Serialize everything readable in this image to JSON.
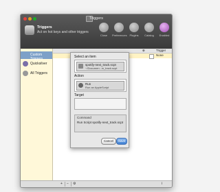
{
  "window": {
    "title": "Triggers"
  },
  "header": {
    "title": "Triggers",
    "subtitle": "Act on hot keys and other triggers"
  },
  "toolbar": {
    "buttons": [
      {
        "label": "Close"
      },
      {
        "label": "Preferences"
      },
      {
        "label": "Plugins"
      },
      {
        "label": "Catalog"
      },
      {
        "label": "Enabled"
      }
    ]
  },
  "sidebar": {
    "items": [
      {
        "label": "Custom Triggers"
      },
      {
        "label": "Quicksilver"
      },
      {
        "label": "All Triggers"
      }
    ]
  },
  "table": {
    "columns": [
      "Trigger"
    ],
    "row": {
      "trigger": "None"
    }
  },
  "sheet": {
    "select_label": "Select an item",
    "selected_item": {
      "title": "spotify-next_track.scpt",
      "subtitle": "~/Documen...in_track.scpt"
    },
    "action_label": "Action",
    "action_item": {
      "title": "Run",
      "subtitle": "Run an AppleScript"
    },
    "target_label": "Target",
    "command_label": "Command",
    "command_text": "Run Script spotify-next_track.scpt",
    "cancel_label": "Cancel",
    "save_label": "Save"
  },
  "bottom": {
    "add_label": "+",
    "remove_label": "−",
    "info_label": "i"
  }
}
